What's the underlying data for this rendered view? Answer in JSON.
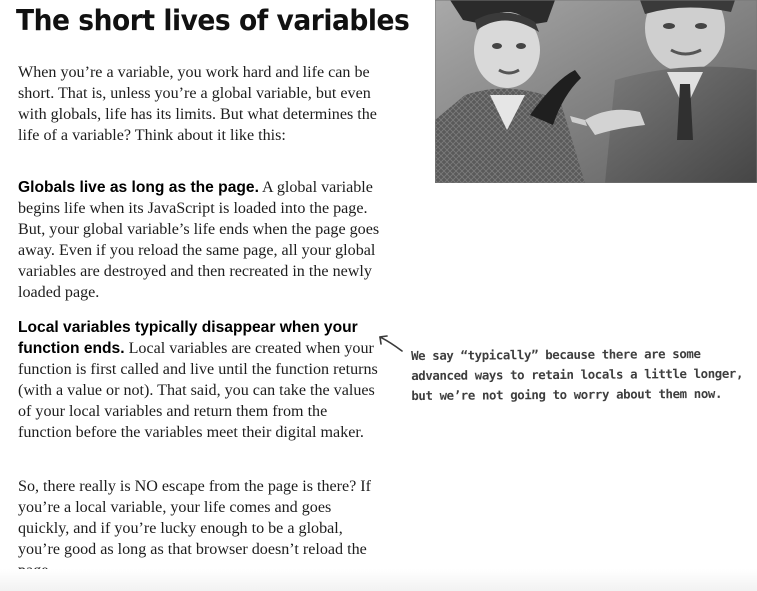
{
  "heading": "The short lives of variables",
  "paragraphs": {
    "intro": "When you’re a variable, you work hard and life can be short. That is, unless you’re a global variable, but even with globals, life has its limits. But what determines the life of a variable? Think about it like this:",
    "globals_lead": "Globals live as long as the page.",
    "globals_text": " A global variable begins life when its JavaScript is loaded into the page. But, your global variable’s life ends when the page goes away. Even if you reload the same page, all your global variables are destroyed and then recreated in the newly loaded page.",
    "locals_lead": "Local variables typically disappear when your function ends.",
    "locals_text": " Local variables are created when your function is first called and live until the function returns (with a value or not).  That said, you can take the values of your local variables and return them from the function before the variables meet their digital maker.",
    "conclusion": "So, there really is NO escape from the page is there? If you’re a local variable, your life comes and goes quickly, and if you’re lucky enough to be a global, you’re good as long as that browser doesn’t reload the page."
  },
  "annotation": {
    "text": "We say “typically” because there are some advanced ways to retain locals a little longer, but we’re not going to worry about them now.",
    "arrow_icon": "hand-drawn-arrow-icon"
  },
  "photo": {
    "icon": "vintage-photo-couple-pointing",
    "style": "black-and-white"
  }
}
